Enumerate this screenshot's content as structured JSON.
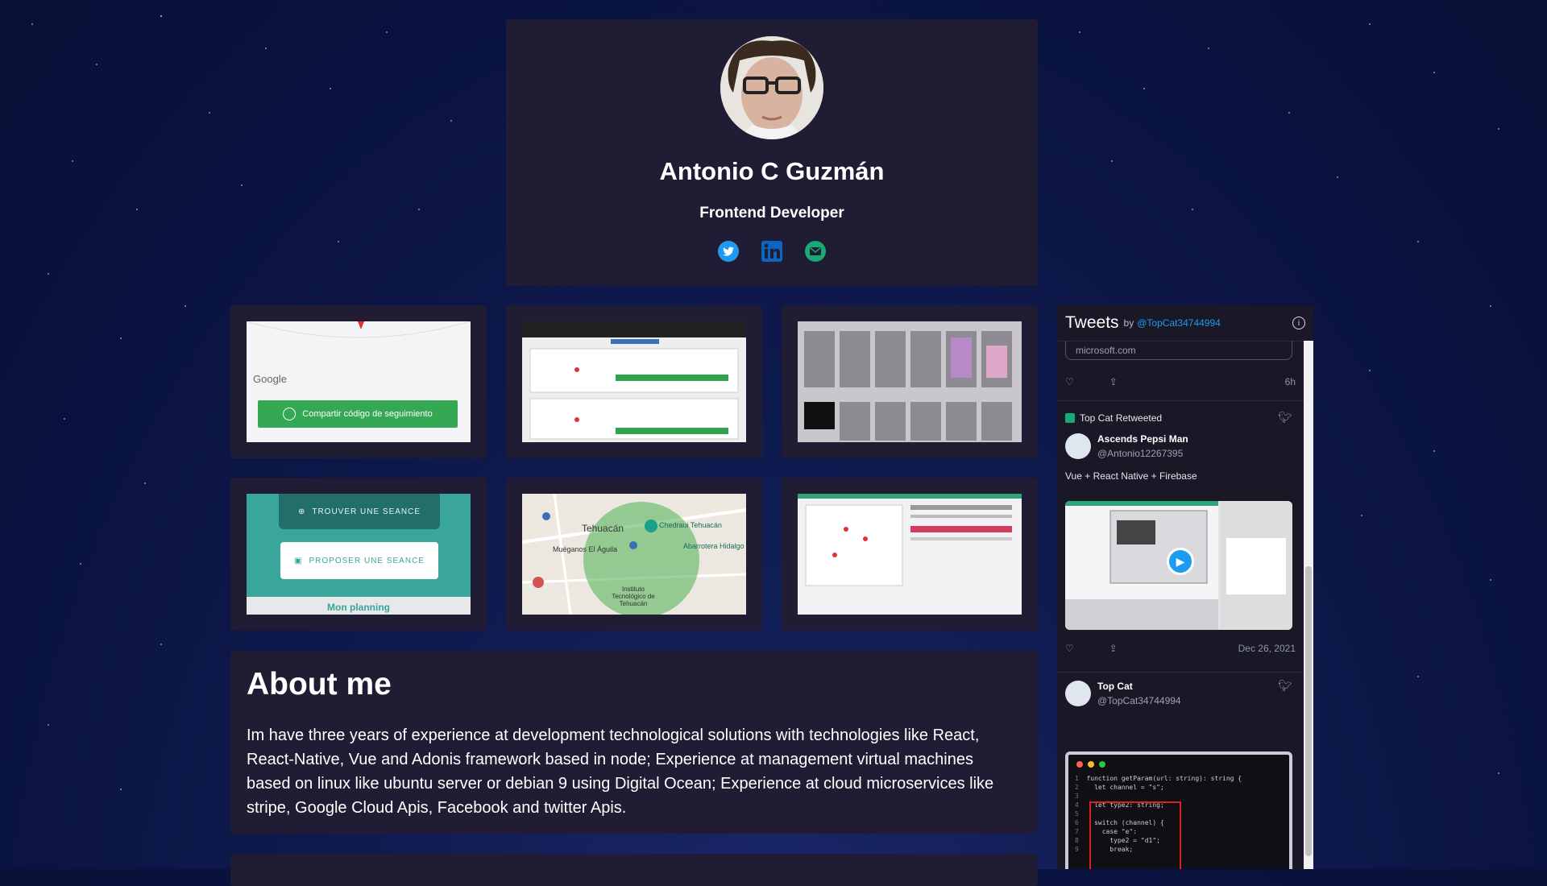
{
  "profile": {
    "name": "Antonio C Guzmán",
    "role": "Frontend Developer",
    "socials": [
      "twitter-icon",
      "linkedin-icon",
      "email-icon"
    ]
  },
  "projects": [
    {
      "name": "project-thumbnail-1",
      "caption": "Compartir código de seguimiento",
      "logo": "Google"
    },
    {
      "name": "project-thumbnail-2"
    },
    {
      "name": "project-thumbnail-3"
    },
    {
      "name": "project-thumbnail-4",
      "btn1": "TROUVER UNE SEANCE",
      "btn2": "PROPOSER UNE SEANCE",
      "footer": "Mon planning"
    },
    {
      "name": "project-thumbnail-5",
      "map_labels": [
        "Tehuacán",
        "Chedraui Tehuacán",
        "Abarrotera Hidalgo",
        "Muéganos El Águila",
        "Instituto Tecnológico de Tehuacán"
      ]
    },
    {
      "name": "project-thumbnail-6"
    }
  ],
  "about": {
    "title": "About me",
    "text": "Im have three years of experience at development technological solutions with technologies like React, React-Native, Vue and Adonis framework based in node; Experience at management virtual machines based on linux like ubuntu server or debian 9 using Digital Ocean; Experience at cloud microservices like stripe, Google Cloud Apis, Facebook and twitter Apis."
  },
  "timeline": {
    "title": "Tweets",
    "by": "by",
    "handle": "@TopCat34744994",
    "tweet1": {
      "link": "microsoft.com",
      "time": "6h"
    },
    "tweet2": {
      "retweet_label": "Top Cat Retweeted",
      "author": "Ascends Pepsi Man",
      "handle": "@Antonio12267395",
      "text": "Vue + React Native + Firebase",
      "date": "Dec 26, 2021"
    },
    "tweet3": {
      "author": "Top Cat",
      "handle": "@TopCat34744994",
      "code": [
        "function getParam(url: string): string {",
        "  let channel = \"s\";",
        "",
        "  let type2: string;",
        "",
        "  switch (channel) {",
        "    case \"e\":",
        "      type2 = \"d1\";",
        "      break;"
      ]
    }
  }
}
